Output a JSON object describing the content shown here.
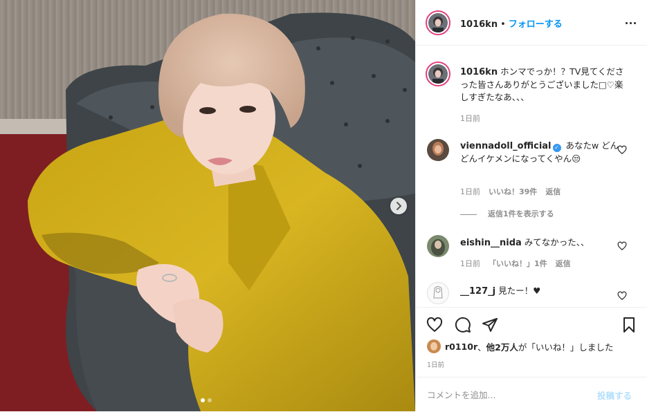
{
  "post": {
    "image_alt": "",
    "carousel": {
      "slide_count": 2,
      "active_index": 0
    }
  },
  "header": {
    "username": "1016kn",
    "separator": "•",
    "follow_label": "フォローする"
  },
  "caption": {
    "username": "1016kn",
    "text": "ホンマでっか！？TV見てくださった皆さんありがとうございました□♡楽しすぎたなあ、、、",
    "time": "1日前"
  },
  "comments": [
    {
      "username": "viennadoll_official",
      "verified": true,
      "text": "あなたw どんどんイケメンになってくやん😒",
      "time": "1日前",
      "likes_label": "いいね！39件",
      "reply_label": "返信"
    },
    {
      "username": "eishin__nida",
      "verified": false,
      "text": "みてなかった、、",
      "time": "1日前",
      "likes_label": "「いいね！」1件",
      "reply_label": "返信"
    },
    {
      "username": "__127_j",
      "verified": false,
      "text": "見たー！♥"
    }
  ],
  "view_replies_label": "返信1件を表示する",
  "likes": {
    "first_user": "r0110r",
    "connector": "、",
    "others": "他2万人",
    "suffix": "が「いいね！」しました"
  },
  "post_time": "1日前",
  "comment_box": {
    "placeholder": "コメントを追加...",
    "post_label": "投稿する"
  },
  "colors": {
    "link_blue": "#0095f6",
    "post_disabled": "#b2dffc",
    "story_ring": "#e13f7b",
    "verified": "#3897f0",
    "meta_gray": "#8e8e8e"
  }
}
